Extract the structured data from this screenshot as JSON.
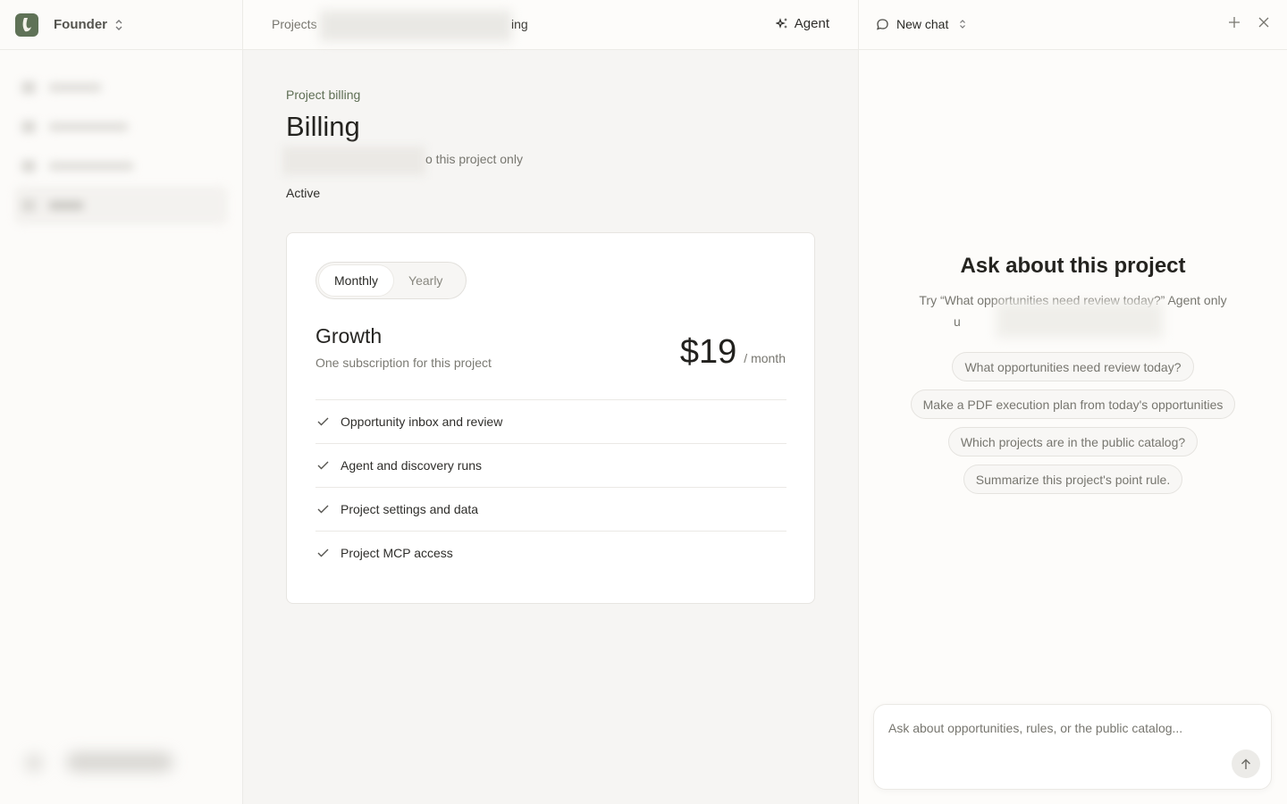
{
  "sidebar": {
    "workspace_name": "Founder",
    "nav_items": [
      {
        "width": 60
      },
      {
        "width": 90
      },
      {
        "width": 96
      },
      {
        "width": 40,
        "active": true
      }
    ]
  },
  "main": {
    "breadcrumb_root": "Projects",
    "breadcrumb_current_partial": "ing",
    "agent_label": "Agent",
    "eyebrow": "Project billing",
    "title": "Billing",
    "subtitle_partial": "o this project only",
    "status": "Active",
    "plan": {
      "toggle": {
        "monthly": "Monthly",
        "yearly": "Yearly",
        "selected": "monthly"
      },
      "name": "Growth",
      "description": "One subscription for this project",
      "price": "$19",
      "period": "/ month",
      "features": [
        "Opportunity inbox and review",
        "Agent and discovery runs",
        "Project settings and data",
        "Project MCP access"
      ]
    }
  },
  "chat": {
    "title": "New chat",
    "heading": "Ask about this project",
    "hint_line1": "Try “What opportunities need review today?” Agent only",
    "hint_line2_partial": "u",
    "suggestions": [
      "What opportunities need review today?",
      "Make a PDF execution plan from today's opportunities",
      "Which projects are in the public catalog?",
      "Summarize this project's point rule."
    ],
    "composer_placeholder": "Ask about opportunities, rules, or the public catalog..."
  },
  "colors": {
    "accent": "#5e6e54",
    "logo": "#5f7257"
  }
}
